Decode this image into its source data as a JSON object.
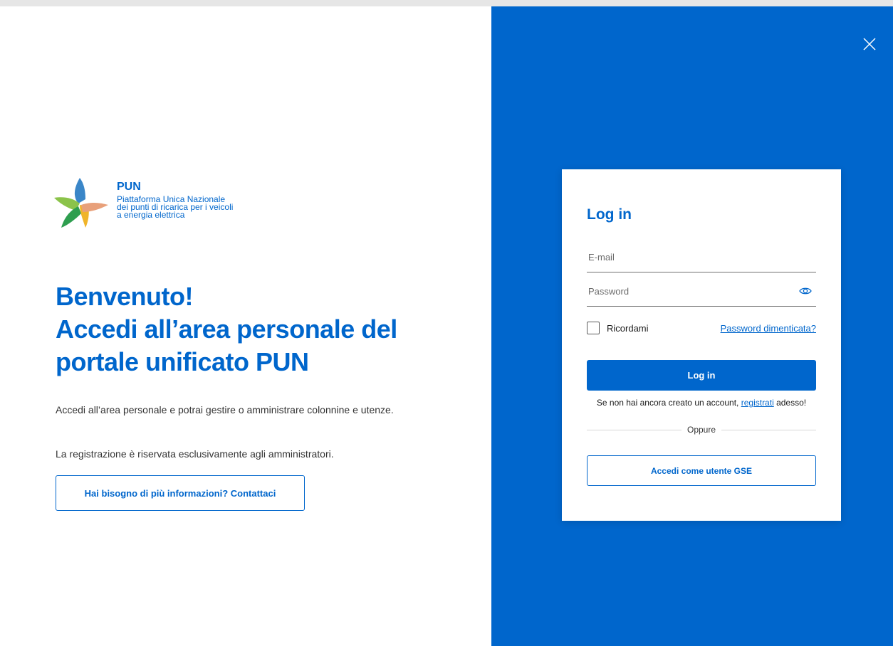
{
  "brand": {
    "name": "PUN",
    "subtitle_lines": [
      "Piattaforma Unica Nazionale",
      "dei punti di ricarica per i veicoli",
      "a energia elettrica"
    ]
  },
  "hero": {
    "title_lines": [
      "Benvenuto!",
      "Accedi all’area personale del",
      "portale unificato PUN"
    ],
    "description": "Accedi all’area personale e potrai gestire o amministrare colonnine e utenze.",
    "note": "La registrazione è riservata esclusivamente agli amministratori.",
    "info_button": "Hai bisogno di più informazioni? Contattaci"
  },
  "login": {
    "title": "Log in",
    "email_placeholder": "E-mail",
    "password_placeholder": "Password",
    "remember_label": "Ricordami",
    "forgot_link": "Password dimenticata?",
    "submit_label": "Log in",
    "register_prefix": "Se non hai ancora creato un account,",
    "register_link": "registrati",
    "register_suffix": "adesso!",
    "divider_label": "Oppure",
    "gse_button": "Accedi come utente GSE"
  },
  "icons": {
    "close": "close-icon",
    "password_visibility": "eye-icon",
    "logo": "pun-star-logo"
  },
  "colors": {
    "accent": "#0066cc",
    "background": "#ffffff"
  }
}
